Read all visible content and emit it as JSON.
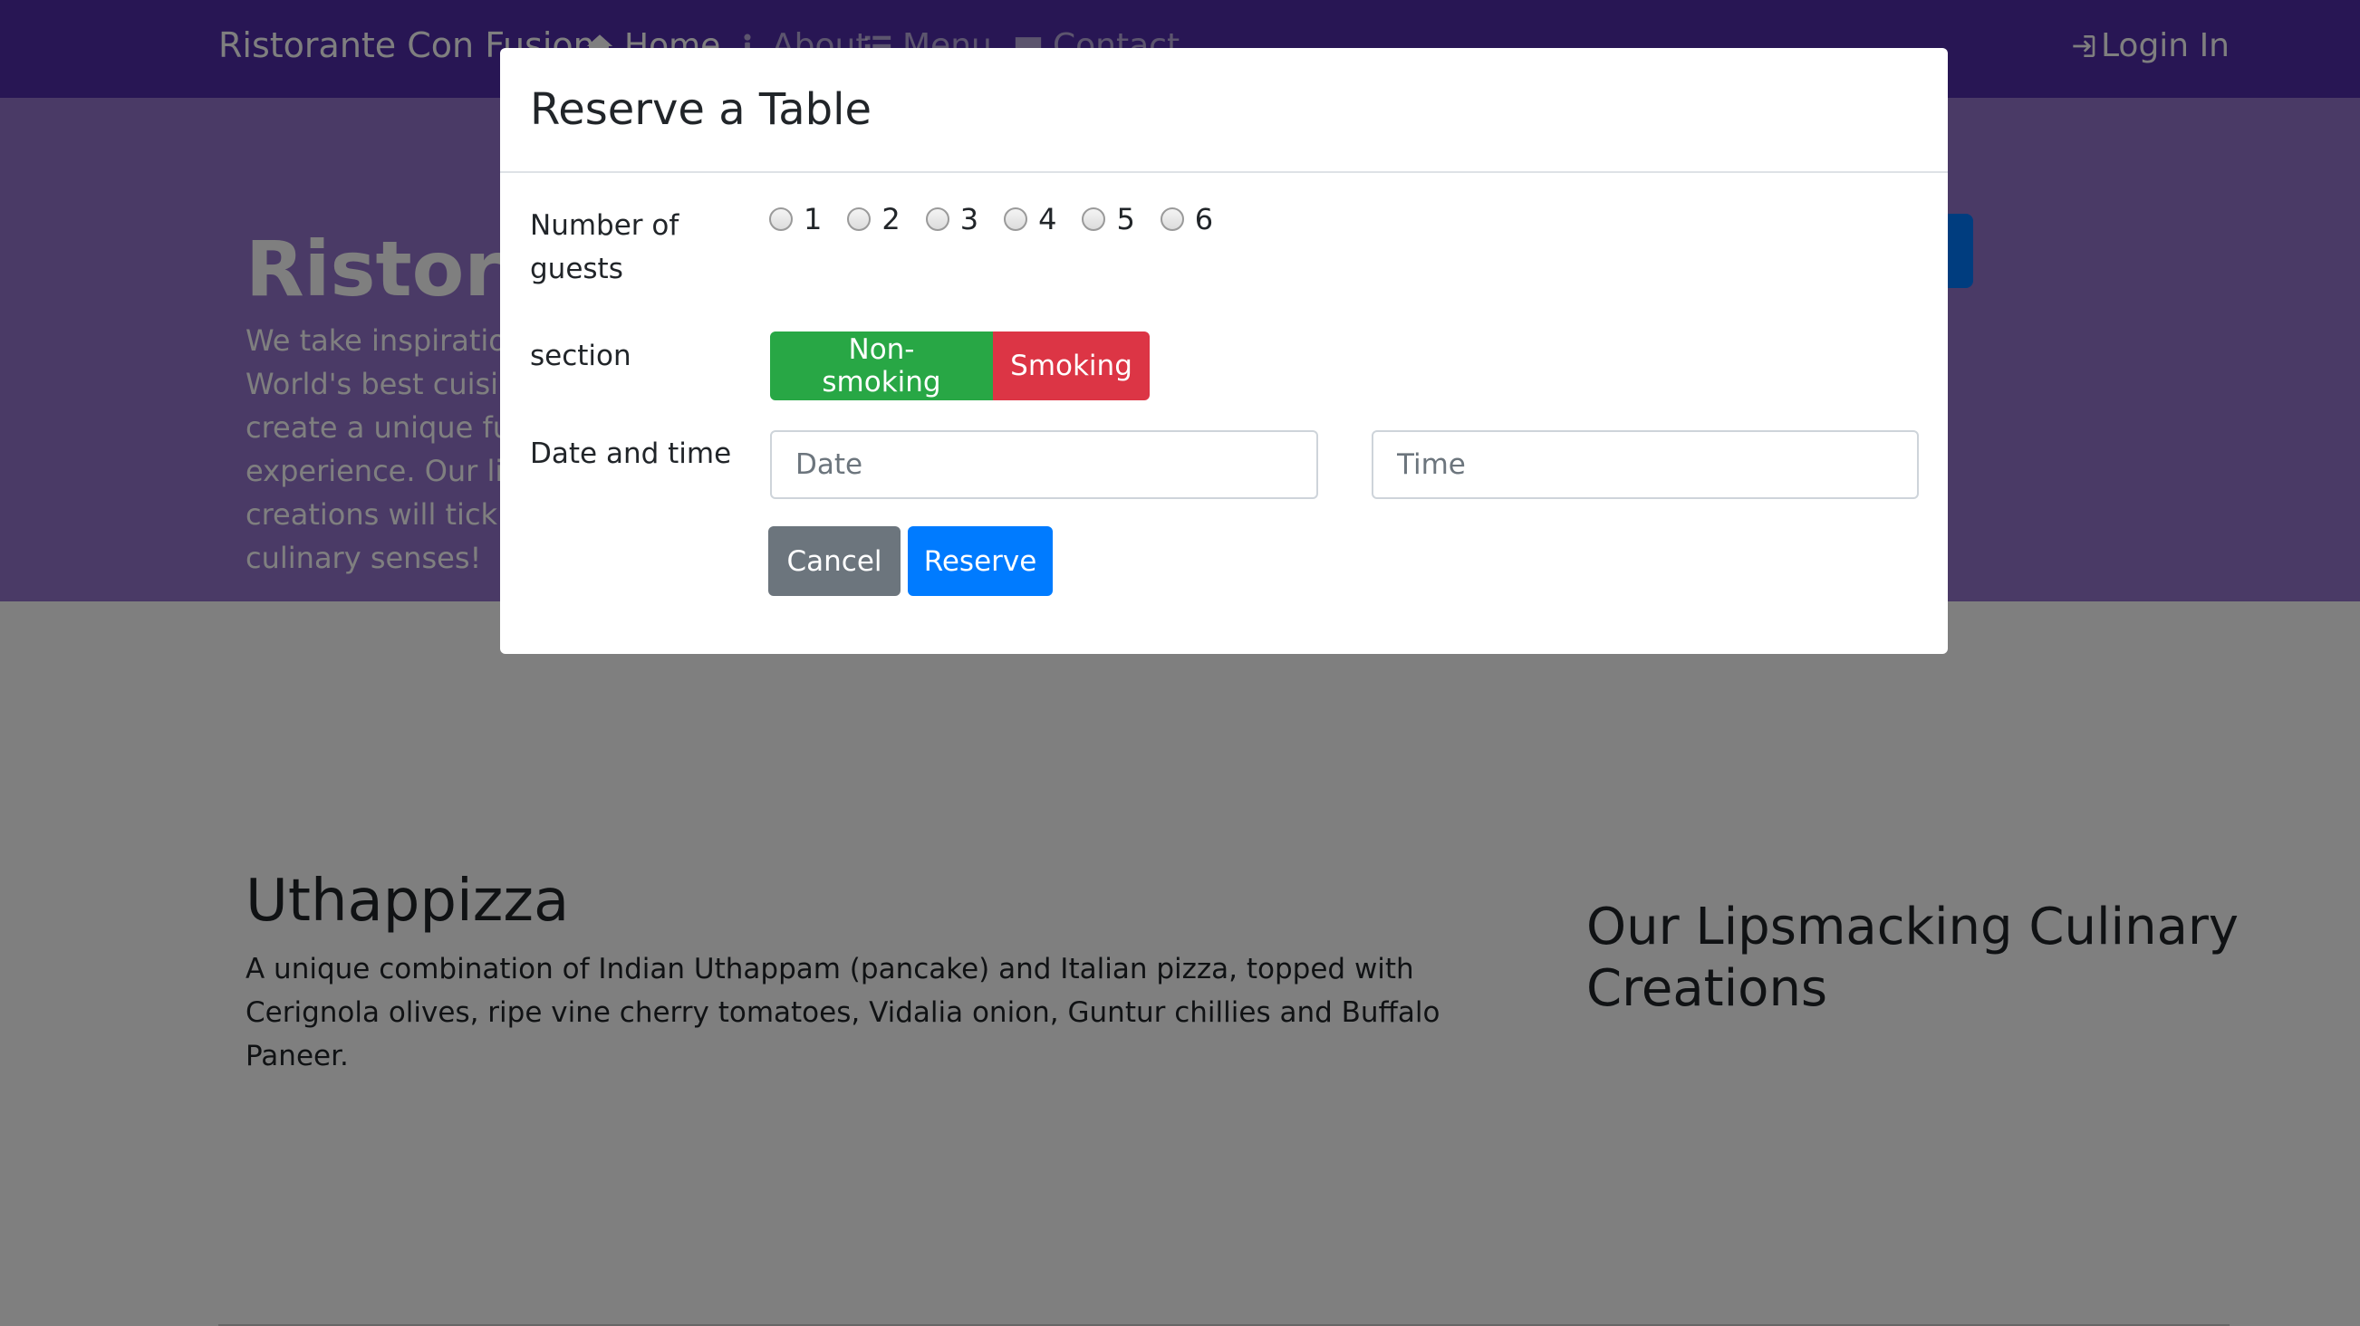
{
  "navbar": {
    "brand": "Ristorante Con Fusion",
    "items": [
      {
        "label": "Home",
        "icon": "home-icon",
        "active": true
      },
      {
        "label": "About",
        "icon": "info-icon",
        "active": false
      },
      {
        "label": "Menu",
        "icon": "list-icon",
        "active": false
      },
      {
        "label": "Contact",
        "icon": "address-card-icon",
        "active": false
      }
    ],
    "login_label": "Login In"
  },
  "jumbotron": {
    "title": "Ristorante Con Fusion",
    "text": "We take inspiration from the World's best cuisines, and create a unique fusion experience. Our lipsmacking creations will tickle your culinary senses!"
  },
  "main": {
    "dish_title": "Uthappizza",
    "dish_description": "A unique combination of Indian Uthappam (pancake) and Italian pizza, topped with Cerignola olives, ripe vine cherry tomatoes, Vidalia onion, Guntur chillies and Buffalo Paneer.",
    "creations_title": "Our Lipsmacking Culinary Creations"
  },
  "modal": {
    "title": "Reserve a Table",
    "guests_label": "Number of guests",
    "guest_options": [
      "1",
      "2",
      "3",
      "4",
      "5",
      "6"
    ],
    "section_label": "section",
    "section_options": {
      "non_smoking": "Non-smoking",
      "smoking": "Smoking"
    },
    "datetime_label": "Date and time",
    "date_placeholder": "Date",
    "time_placeholder": "Time",
    "cancel_label": "Cancel",
    "reserve_label": "Reserve"
  },
  "colors": {
    "navbar": "#512da8",
    "jumbotron": "#9575cd",
    "success": "#28a745",
    "danger": "#dc3545",
    "primary": "#007bff",
    "secondary": "#6c757d"
  }
}
